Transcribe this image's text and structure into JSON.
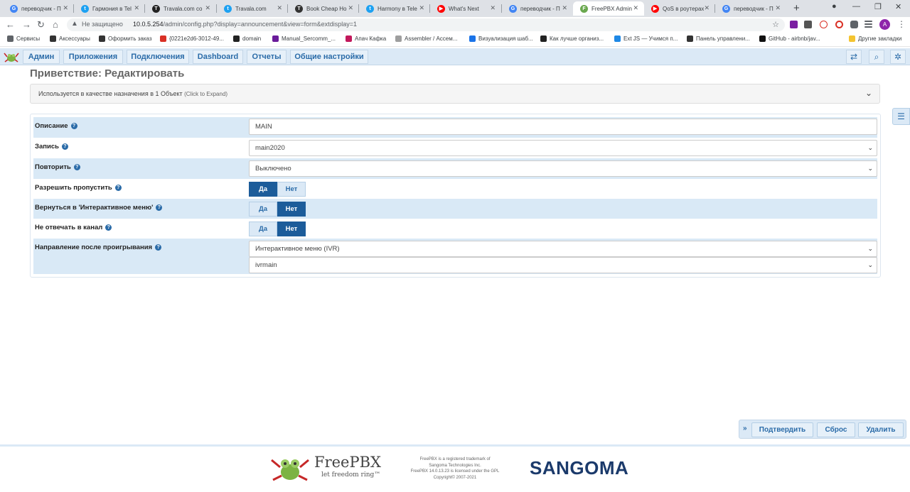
{
  "browser": {
    "tabs": [
      {
        "title": "переводчик - П",
        "icon": "google-icon",
        "color": "#4285f4",
        "glyph": "G"
      },
      {
        "title": "Гармония в Tel",
        "icon": "twitter-icon",
        "color": "#1da1f2",
        "glyph": "t"
      },
      {
        "title": "Travala.com co",
        "icon": "travala-icon",
        "color": "#222222",
        "glyph": "T"
      },
      {
        "title": "Travala.com",
        "icon": "twitter-icon",
        "color": "#1da1f2",
        "glyph": "t"
      },
      {
        "title": "Book Cheap Ho",
        "icon": "travala-icon",
        "color": "#333333",
        "glyph": "T"
      },
      {
        "title": "Harmony в Tele",
        "icon": "twitter-icon",
        "color": "#1da1f2",
        "glyph": "t"
      },
      {
        "title": "What's Next",
        "icon": "youtube-icon",
        "color": "#ff0000",
        "glyph": "▶"
      },
      {
        "title": "переводчик - П",
        "icon": "google-icon",
        "color": "#4285f4",
        "glyph": "G"
      },
      {
        "title": "FreePBX Admin",
        "icon": "freepbx-icon",
        "color": "#6aa84f",
        "glyph": "F",
        "active": true
      },
      {
        "title": "QoS в роутерах",
        "icon": "youtube-icon",
        "color": "#ff0000",
        "glyph": "▶"
      },
      {
        "title": "переводчик - П",
        "icon": "google-icon",
        "color": "#4285f4",
        "glyph": "G"
      }
    ],
    "not_secure": "Не защищено",
    "url_host": "10.0.5.254",
    "url_path": "/admin/config.php?display=announcement&view=form&extdisplay=1",
    "avatar_letter": "A",
    "bookmarks": [
      {
        "label": "Сервисы",
        "color": "#5f6368"
      },
      {
        "label": "Аксессуары",
        "color": "#333333"
      },
      {
        "label": "Оформить заказ",
        "color": "#333333"
      },
      {
        "label": "{0221e2d6-3012-49...",
        "color": "#d93025"
      },
      {
        "label": "domain",
        "color": "#222222"
      },
      {
        "label": "Manual_Sercomm_...",
        "color": "#6a1b9a"
      },
      {
        "label": "Апач Кафка",
        "color": "#c2185b"
      },
      {
        "label": "Assembler / Ассем...",
        "color": "#9e9e9e"
      },
      {
        "label": "Визуализация шаб...",
        "color": "#1a73e8"
      },
      {
        "label": "Как лучше организ...",
        "color": "#222222"
      },
      {
        "label": "Ext JS — Учимся п...",
        "color": "#1e88e5"
      },
      {
        "label": "Панель управлени...",
        "color": "#333333"
      },
      {
        "label": "GitHub - airbnb/jav...",
        "color": "#111111"
      }
    ],
    "other_bookmarks": "Другие закладки"
  },
  "nav": {
    "items": [
      "Админ",
      "Приложения",
      "Подключения",
      "Dashboard",
      "Отчеты",
      "Общие настройки"
    ]
  },
  "page": {
    "title": "Приветствие: Редактировать",
    "usage_text": "Используется в качестве назначения в 1 Объект",
    "usage_hint": "(Click to Expand)"
  },
  "form": {
    "description_label": "Описание",
    "description_value": "MAIN",
    "recording_label": "Запись",
    "recording_value": "main2020",
    "repeat_label": "Повторить",
    "repeat_value": "Выключено",
    "allow_skip_label": "Разрешить пропустить",
    "return_ivr_label": "Вернуться в 'Интерактивное меню'",
    "no_answer_label": "Не отвечать в канал",
    "destination_label": "Направление после проигрывания",
    "destination_type": "Интерактивное меню (IVR)",
    "destination_value": "ivrmain",
    "yes": "Да",
    "no": "Нет",
    "allow_skip": "yes",
    "return_ivr": "no",
    "no_answer": "no"
  },
  "actions": {
    "submit": "Подтвердить",
    "reset": "Сброс",
    "delete": "Удалить"
  },
  "footer": {
    "brand": "FreePBX",
    "tagline": "let freedom ring™",
    "legal_1": "FreePBX is a registered trademark of",
    "legal_2": "Sangoma Technologies Inc.",
    "legal_3": "FreePBX 14.0.13.23 is licensed under the GPL",
    "legal_4": "Copyright© 2007-2021",
    "sangoma": "SANGOMA"
  },
  "colors": {
    "accent": "#2a6ba8",
    "toggle_on": "#1c5c9a",
    "row_shade": "#d9e9f6"
  }
}
